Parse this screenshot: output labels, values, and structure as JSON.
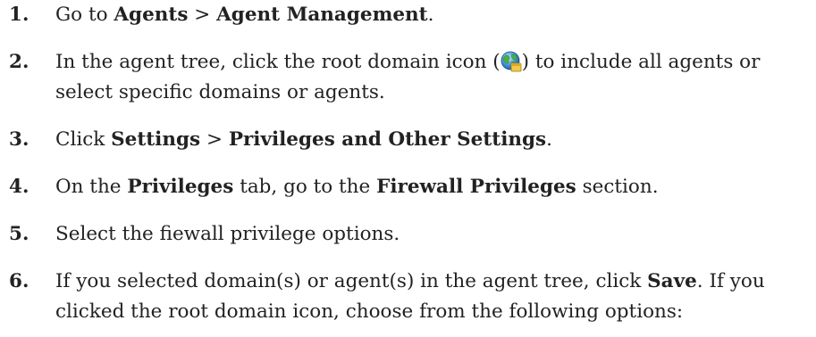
{
  "steps": [
    {
      "num": "1.",
      "t1": "Go to ",
      "b1": "Agents",
      "t2": " > ",
      "b2": "Agent Management",
      "t3": "."
    },
    {
      "num": "2.",
      "t1": "In the agent tree, click the root domain icon (",
      "icon": "root-domain-globe-icon",
      "t2": ") to include all agents or",
      "t3": "select specific domains or agents."
    },
    {
      "num": "3.",
      "t1": "Click ",
      "b1": "Settings",
      "t2": " > ",
      "b2": "Privileges and Other Settings",
      "t3": "."
    },
    {
      "num": "4.",
      "t1": "On the ",
      "b1": "Privileges",
      "t2": " tab, go to the ",
      "b2": "Firewall Privileges",
      "t3": " section."
    },
    {
      "num": "5.",
      "t1": "Select the fiewall privilege options."
    },
    {
      "num": "6.",
      "t1": "If you selected domain(s) or agent(s) in the agent tree, click ",
      "b1": "Save",
      "t2": ". If you",
      "t3": "clicked the root domain icon, choose from the following options:"
    }
  ]
}
